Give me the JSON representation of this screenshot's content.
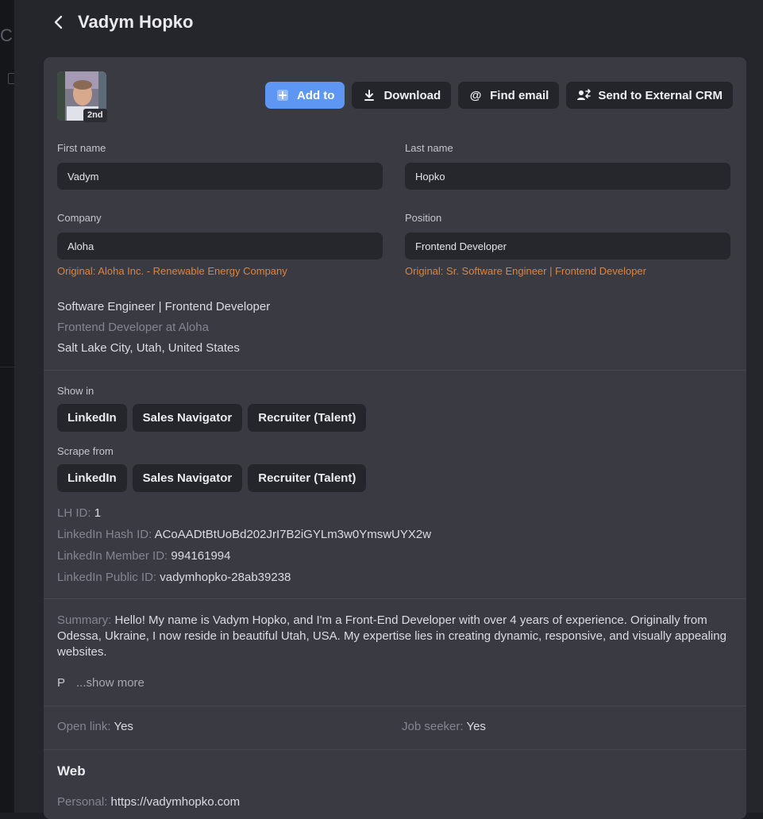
{
  "background": {
    "partial_letter": "C"
  },
  "header": {
    "title": "Vadym Hopko"
  },
  "profile": {
    "connection_degree": "2nd"
  },
  "actions": {
    "add_to": "Add to",
    "download": "Download",
    "find_email": "Find email",
    "send_crm": "Send to External CRM"
  },
  "fields": {
    "first_name": {
      "label": "First name",
      "value": "Vadym"
    },
    "last_name": {
      "label": "Last name",
      "value": "Hopko"
    },
    "company": {
      "label": "Company",
      "value": "Aloha",
      "original": "Original: Aloha Inc. - Renewable Energy Company"
    },
    "position": {
      "label": "Position",
      "value": "Frontend Developer",
      "original": "Original: Sr. Software Engineer | Frontend Developer"
    }
  },
  "headline": {
    "title": "Software Engineer | Frontend Developer",
    "current": "Frontend Developer at Aloha",
    "location": "Salt Lake City, Utah, United States"
  },
  "show_in": {
    "label": "Show in",
    "items": [
      "LinkedIn",
      "Sales Navigator",
      "Recruiter (Talent)"
    ]
  },
  "scrape_from": {
    "label": "Scrape from",
    "items": [
      "LinkedIn",
      "Sales Navigator",
      "Recruiter (Talent)"
    ]
  },
  "ids": {
    "lh_id": {
      "label": "LH ID:",
      "value": "1"
    },
    "hash_id": {
      "label": "LinkedIn Hash ID:",
      "value": "ACoAADtBtUoBd202JrI7B2iGYLm3w0YmswUYX2w"
    },
    "member_id": {
      "label": "LinkedIn Member ID:",
      "value": "994161994"
    },
    "public_id": {
      "label": "LinkedIn Public ID:",
      "value": "vadymhopko-28ab39238"
    }
  },
  "summary": {
    "label": "Summary:",
    "text": "Hello! My name is Vadym Hopko, and I'm a Front-End Developer with over 4 years of experience. Originally from Odessa, Ukraine, I now reside in beautiful Utah, USA. My expertise lies in creating dynamic, responsive, and visually appealing websites.",
    "truncated": "P",
    "show_more": "...show more"
  },
  "flags": {
    "open_link": {
      "label": "Open link:",
      "value": "Yes"
    },
    "job_seeker": {
      "label": "Job seeker:",
      "value": "Yes"
    }
  },
  "web": {
    "title": "Web",
    "personal": {
      "label": "Personal:",
      "value": "https://vadymhopko.com"
    }
  },
  "colors": {
    "accent": "#5e97f3",
    "original_text": "#e0833a",
    "card_bg": "#393a42",
    "page_bg": "#25262c"
  }
}
